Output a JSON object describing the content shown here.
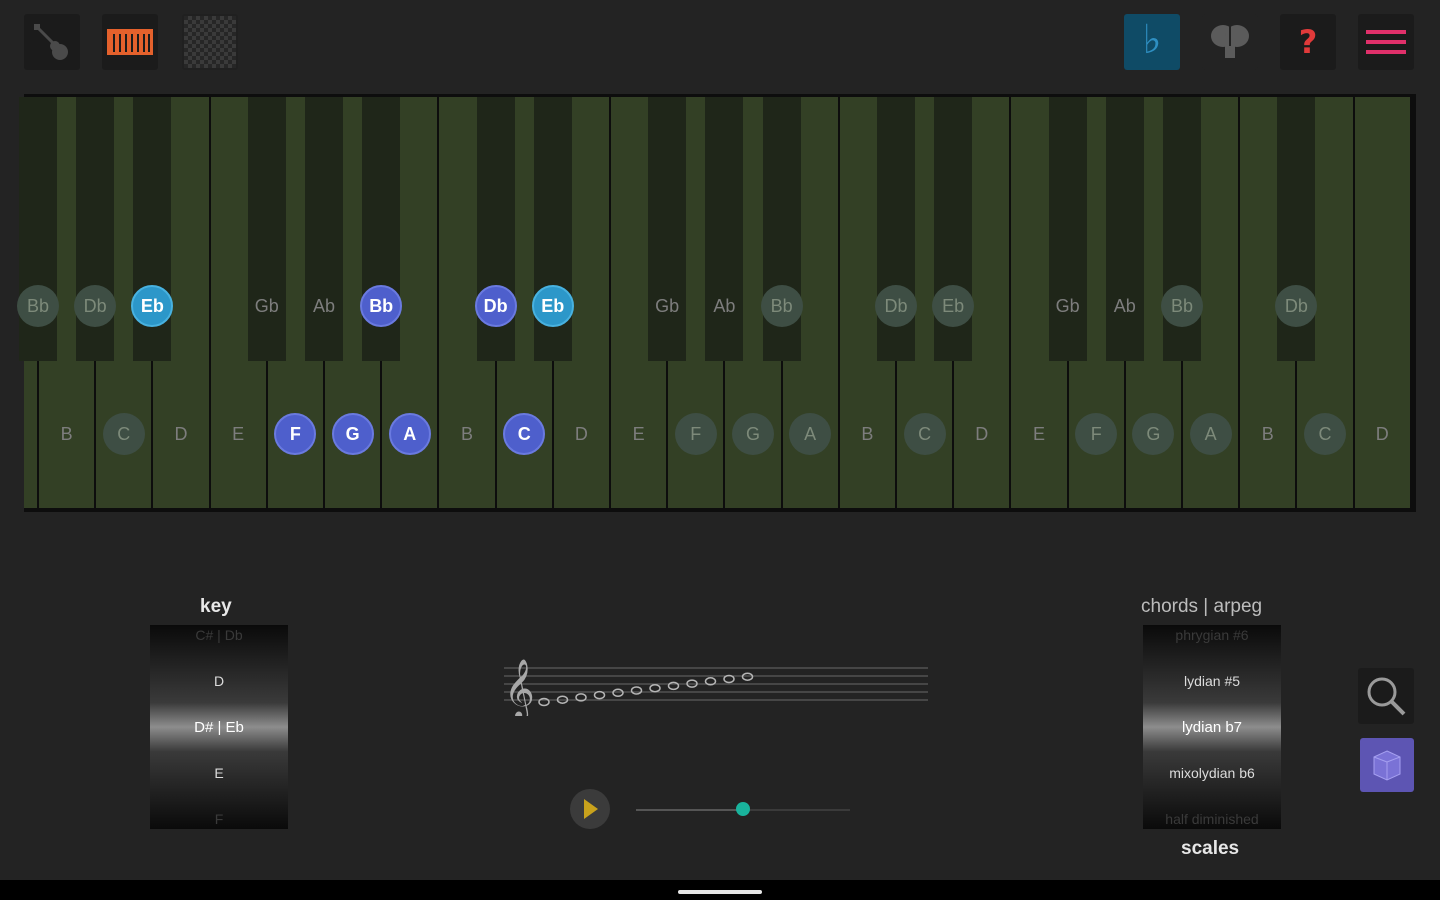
{
  "toolbar": {
    "left": [
      {
        "name": "guitar-icon"
      },
      {
        "name": "piano-icon"
      },
      {
        "name": "checkerboard-icon"
      }
    ],
    "right": [
      {
        "name": "flat-icon",
        "glyph": "♭"
      },
      {
        "name": "brain-icon"
      },
      {
        "name": "help-icon",
        "glyph": "?"
      },
      {
        "name": "menu-icon"
      }
    ]
  },
  "keyboard": {
    "white_keys": [
      {
        "label": "B",
        "state": "dim"
      },
      {
        "label": "C",
        "state": "ghost"
      },
      {
        "label": "D",
        "state": "dim"
      },
      {
        "label": "E",
        "state": "dim"
      },
      {
        "label": "F",
        "state": "blue"
      },
      {
        "label": "G",
        "state": "blue"
      },
      {
        "label": "A",
        "state": "blue"
      },
      {
        "label": "B",
        "state": "dim"
      },
      {
        "label": "C",
        "state": "blue"
      },
      {
        "label": "D",
        "state": "dim"
      },
      {
        "label": "E",
        "state": "dim"
      },
      {
        "label": "F",
        "state": "ghost"
      },
      {
        "label": "G",
        "state": "ghost"
      },
      {
        "label": "A",
        "state": "ghost"
      },
      {
        "label": "B",
        "state": "dim"
      },
      {
        "label": "C",
        "state": "ghost"
      },
      {
        "label": "D",
        "state": "dim"
      },
      {
        "label": "E",
        "state": "dim"
      },
      {
        "label": "F",
        "state": "ghost"
      },
      {
        "label": "G",
        "state": "ghost"
      },
      {
        "label": "A",
        "state": "ghost"
      },
      {
        "label": "B",
        "state": "dim"
      },
      {
        "label": "C",
        "state": "ghost"
      },
      {
        "label": "D",
        "state": "dim"
      }
    ],
    "black_keys": [
      {
        "label": "Bb",
        "state": "ghost"
      },
      {
        "label": "Db",
        "state": "ghost"
      },
      {
        "label": "Eb",
        "state": "cyan"
      },
      {
        "label": "Gb",
        "state": "dim"
      },
      {
        "label": "Ab",
        "state": "dim"
      },
      {
        "label": "Bb",
        "state": "blue"
      },
      {
        "label": "Db",
        "state": "blue"
      },
      {
        "label": "Eb",
        "state": "cyan"
      },
      {
        "label": "Gb",
        "state": "dim"
      },
      {
        "label": "Ab",
        "state": "dim"
      },
      {
        "label": "Bb",
        "state": "ghost"
      },
      {
        "label": "Db",
        "state": "ghost"
      },
      {
        "label": "Eb",
        "state": "ghost"
      },
      {
        "label": "Gb",
        "state": "dim"
      },
      {
        "label": "Ab",
        "state": "dim"
      },
      {
        "label": "Bb",
        "state": "ghost"
      },
      {
        "label": "Db",
        "state": "ghost"
      }
    ]
  },
  "key_selector": {
    "label": "key",
    "items": [
      "C# | Db",
      "D",
      "D# | Eb",
      "E",
      "F"
    ],
    "selected": "D# | Eb"
  },
  "scale_selector": {
    "header": "chords  |  arpeg",
    "label": "scales",
    "items": [
      "phrygian #6",
      "lydian #5",
      "lydian b7",
      "mixolydian b6",
      "half diminished"
    ],
    "selected": "lydian b7"
  },
  "player": {
    "tempo_value": 0.5
  },
  "colors": {
    "accent_blue": "#4e5fcc",
    "accent_cyan": "#2c97c9",
    "menu_red": "#e0306a",
    "slider_thumb": "#19b39c"
  }
}
